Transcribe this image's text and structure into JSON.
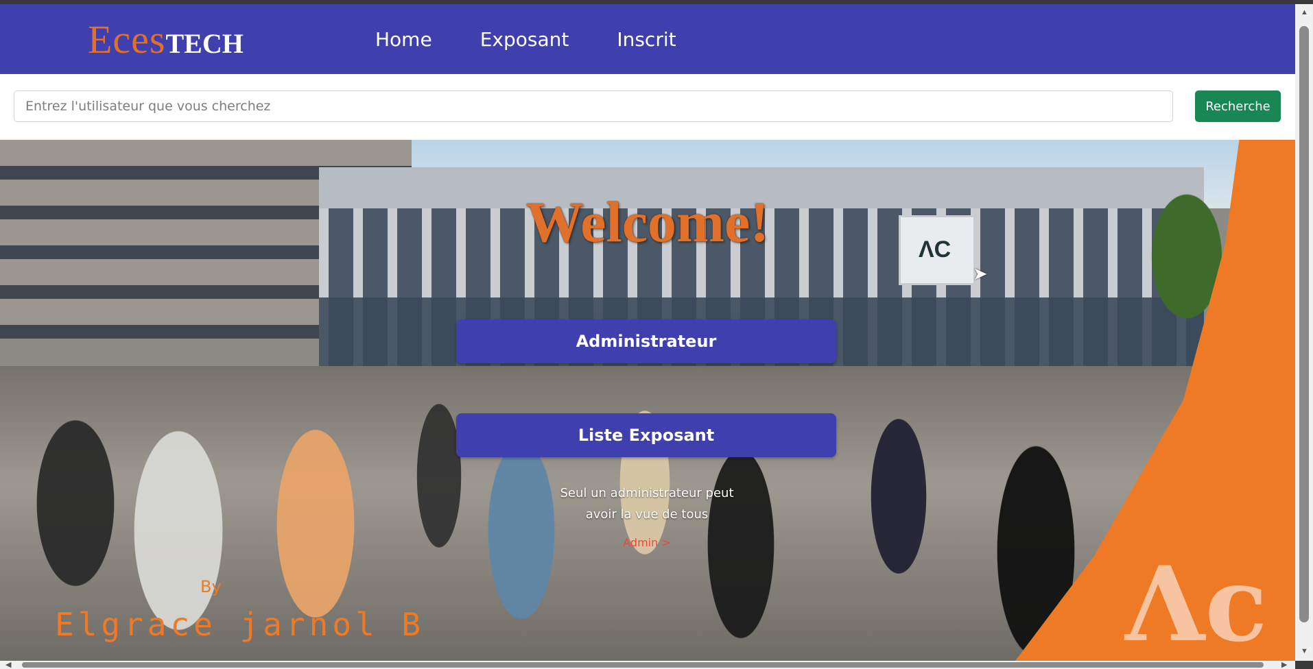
{
  "navbar": {
    "brand_part1": "Eces",
    "brand_part2": "TECH",
    "links": [
      "Home",
      "Exposant",
      "Inscrit"
    ]
  },
  "search": {
    "placeholder": "Entrez l'utilisateur que vous cherchez",
    "value": "",
    "button_label": "Recherche"
  },
  "hero": {
    "title": "Welcome!",
    "admin_button": "Administrateur",
    "list_button": "Liste Exposant",
    "note_line1": "Seul un administrateur peut",
    "note_line2": "avoir la vue de tous",
    "admin_link": "Admin >",
    "by_label": "By",
    "author": "Elgrace jarnol B"
  },
  "colors": {
    "navbar": "#3f3fae",
    "accent_orange": "#ee7a25",
    "search_button": "#198754"
  },
  "icons": {
    "cursor": "mouse-pointer-icon"
  }
}
